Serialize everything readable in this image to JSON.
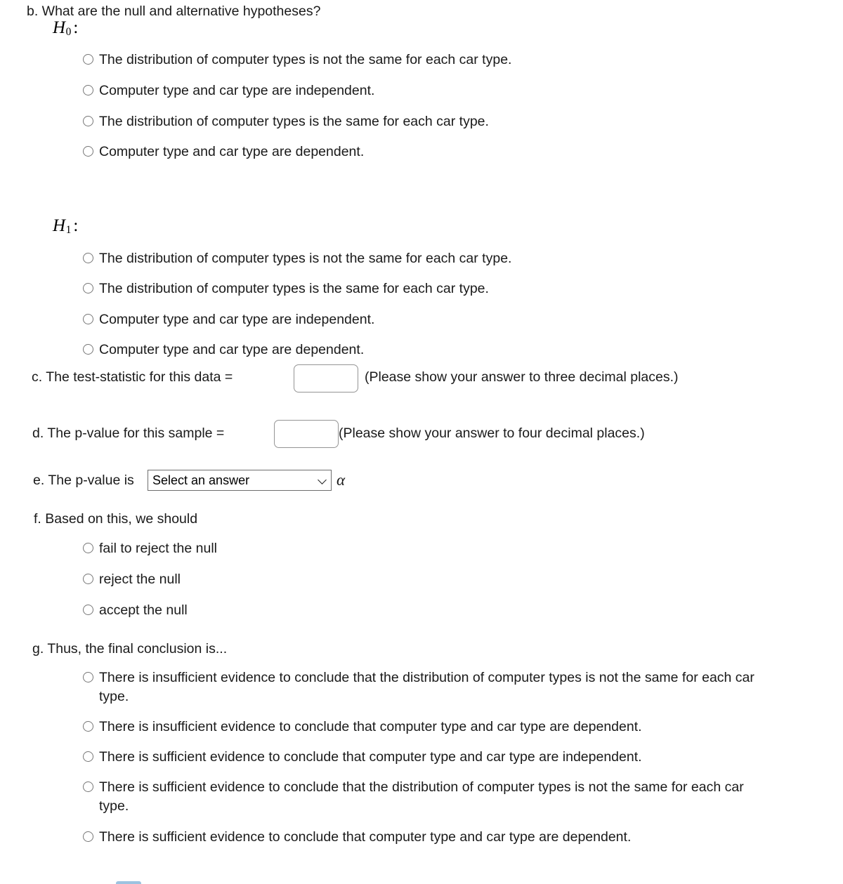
{
  "question_b": {
    "prompt": "b. What are the null and alternative hypotheses?",
    "h0": {
      "symbol": "H",
      "subscript": "0",
      "colon": ":",
      "options": [
        "The distribution of computer types is not the same for each car type.",
        "Computer type and car type are independent.",
        "The distribution of computer types is the same for each car type.",
        "Computer type and car type are dependent."
      ]
    },
    "h1": {
      "symbol": "H",
      "subscript": "1",
      "colon": ":",
      "options": [
        "The distribution of computer types is not the same for each car type.",
        "The distribution of computer types is the same for each car type.",
        "Computer type and car type are independent.",
        "Computer type and car type are dependent."
      ]
    }
  },
  "question_c": {
    "label": "c. The test-statistic for this data =",
    "input_value": "",
    "input_placeholder": "",
    "hint": "(Please show your answer to three decimal places.)"
  },
  "question_d": {
    "label": "d. The p-value for this sample =",
    "input_value": "",
    "input_placeholder": "",
    "hint": "(Please show your answer to four decimal places.)"
  },
  "question_e": {
    "label": "e. The p-value is",
    "select_value": "Select an answer",
    "select_options": [
      "Select an answer"
    ],
    "alpha": "α"
  },
  "question_f": {
    "label": "f. Based on this, we should",
    "options": [
      "fail to reject the null",
      "reject the null",
      "accept the null"
    ]
  },
  "question_g": {
    "label": "g. Thus, the final conclusion is...",
    "options": [
      "There is insufficient evidence to conclude that the distribution of computer types is not the same for each car type.",
      "There is insufficient evidence to conclude that computer type and car type are dependent.",
      "There is sufficient evidence to conclude that computer type and car type are independent.",
      "There is sufficient evidence to conclude that the distribution of computer types is not the same for each car type.",
      "There is sufficient evidence to conclude that computer type and car type are dependent."
    ]
  },
  "colors": {
    "text": "#1a1a1a",
    "radio_border": "#767676",
    "input_border": "#949494",
    "submit_button": "#9dc3e0"
  }
}
